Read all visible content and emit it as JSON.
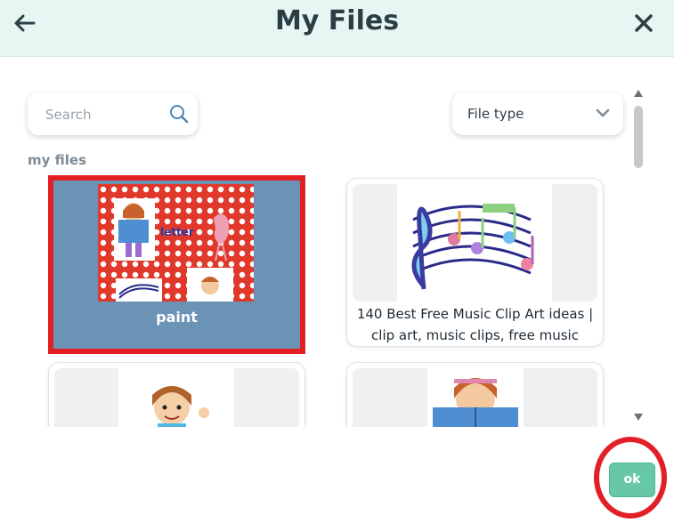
{
  "header": {
    "title": "My Files",
    "back_icon": "arrow-left-icon",
    "close_icon": "close-icon"
  },
  "search": {
    "placeholder": "Search",
    "value": "",
    "icon": "search-icon"
  },
  "filter": {
    "label": "File type",
    "icon": "chevron-down-icon"
  },
  "section": {
    "label": "my files"
  },
  "files": [
    {
      "caption": "paint",
      "selected": true,
      "thumb_text": "letter"
    },
    {
      "caption_line1": "140 Best Free Music Clip Art ideas |",
      "caption_line2": "clip art, music clips, free music",
      "selected": false
    },
    {
      "caption": "",
      "selected": false
    },
    {
      "caption": "",
      "selected": false
    }
  ],
  "footer": {
    "ok_label": "ok"
  },
  "colors": {
    "accent": "#67c8a8",
    "selection": "#e31f26",
    "header_bg": "#e6f6f2"
  }
}
